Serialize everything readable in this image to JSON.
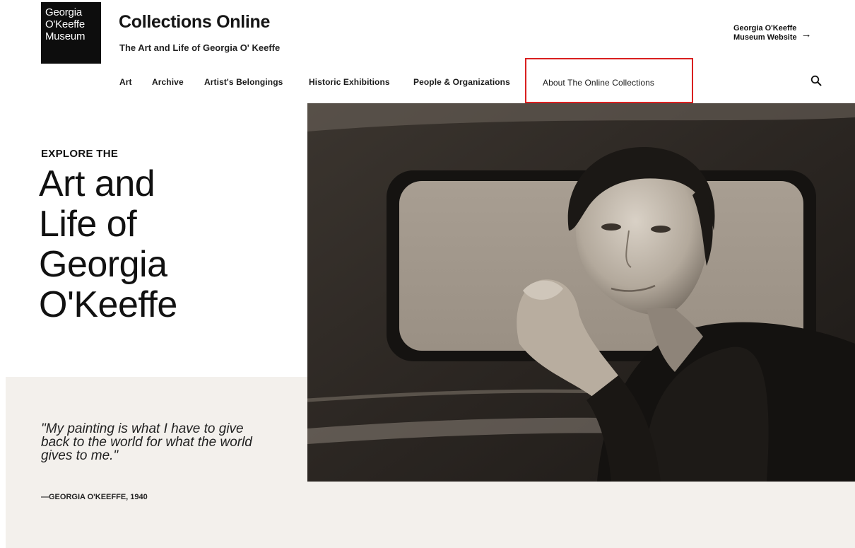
{
  "logo": {
    "lines": [
      "Georgia",
      "O'Keeffe",
      "Museum"
    ]
  },
  "header": {
    "title": "Collections Online",
    "subtitle": "The Art and Life of Georgia O' Keeffe",
    "external_link": {
      "lines": [
        "Georgia O'Keeffe",
        "Museum Website"
      ],
      "arrow": "→"
    }
  },
  "nav": {
    "items": [
      "Art",
      "Archive",
      "Artist's Belongings",
      "Historic Exhibitions",
      "People & Organizations",
      "About The Online Collections"
    ],
    "search_icon": "search-icon"
  },
  "hero": {
    "eyebrow": "EXPLORE THE",
    "heading_lines": [
      "Art and",
      "Life of",
      "Georgia",
      "O'Keeffe"
    ],
    "quote": "\"My painting is what I have to give back to the world for what the world gives to me.\"",
    "attribution": "—GEORGIA O'KEEFFE, 1940"
  },
  "colors": {
    "highlight_border": "#d92020",
    "beige_panel": "#f3f0ec",
    "logo_bg": "#0d0d0d"
  }
}
